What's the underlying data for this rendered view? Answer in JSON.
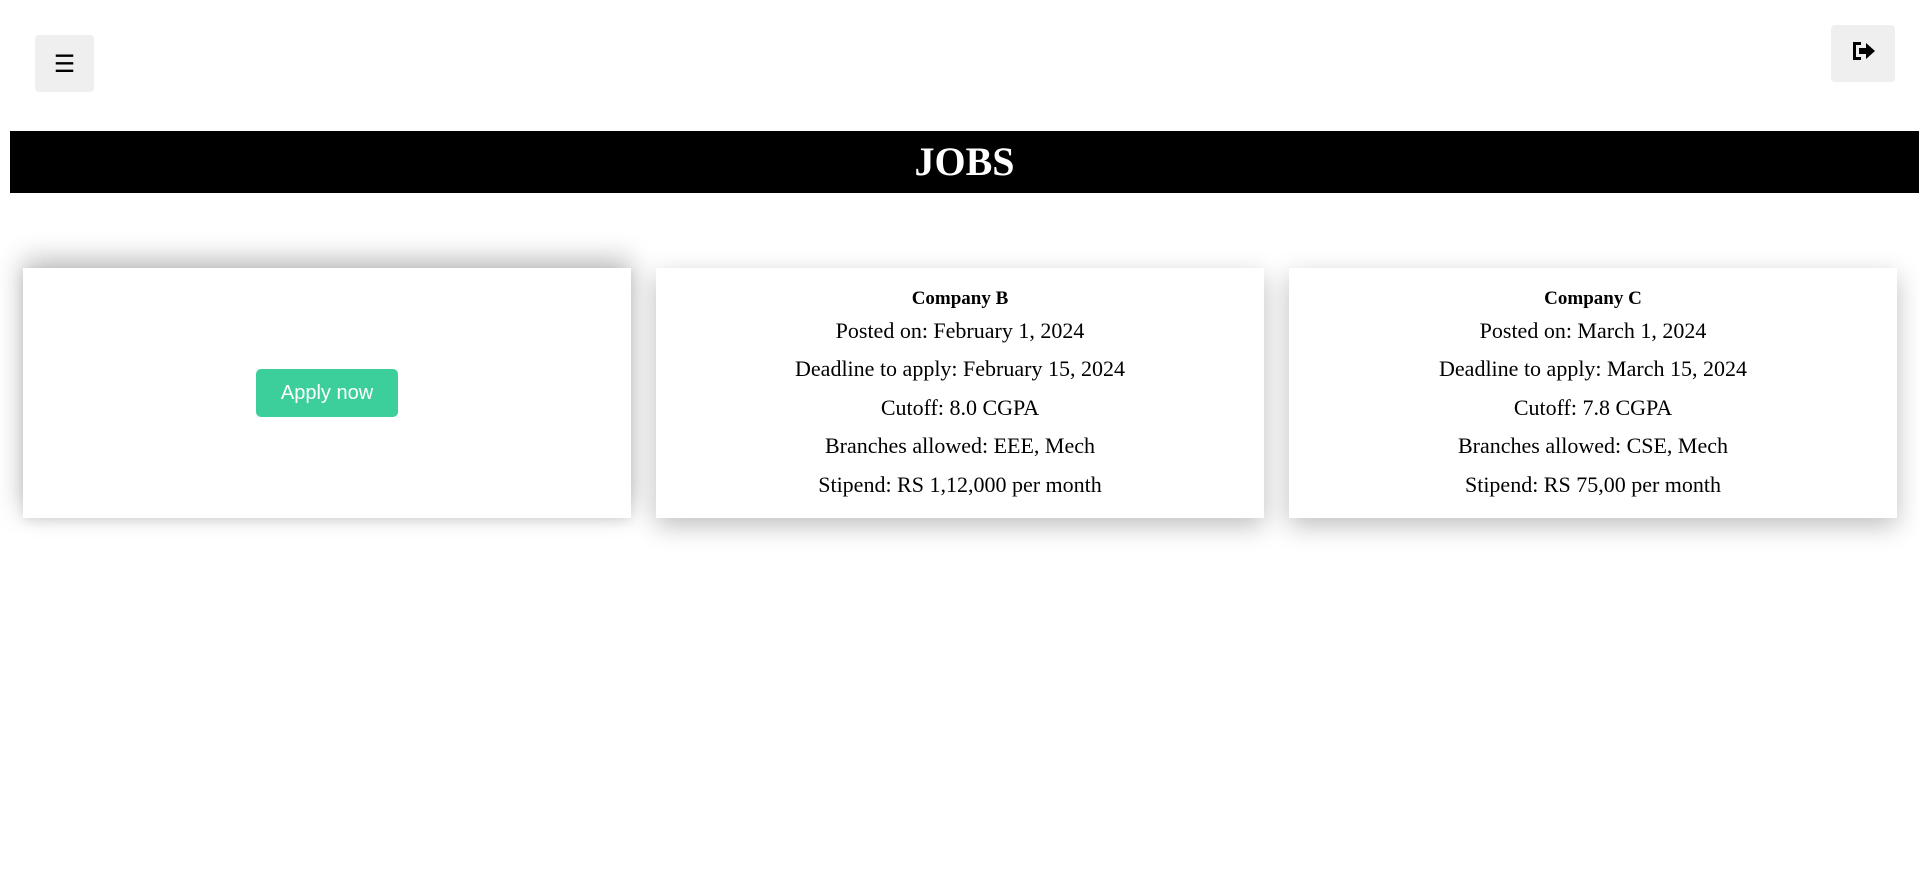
{
  "header": {
    "menu_icon": "☰",
    "logout_icon": "sign-out-icon",
    "title": "JOBS"
  },
  "cards": [
    {
      "apply_label": "Apply now"
    },
    {
      "company": "Company B",
      "posted": "Posted on: February 1, 2024",
      "deadline": "Deadline to apply: February 15, 2024",
      "cutoff": "Cutoff: 8.0 CGPA",
      "branches": "Branches allowed: EEE, Mech",
      "stipend": "Stipend: RS 1,12,000 per month"
    },
    {
      "company": "Company C",
      "posted": "Posted on: March 1, 2024",
      "deadline": "Deadline to apply: March 15, 2024",
      "cutoff": "Cutoff: 7.8 CGPA",
      "branches": "Branches allowed: CSE, Mech",
      "stipend": "Stipend: RS 75,00 per month"
    }
  ],
  "colors": {
    "banner_bg": "#000000",
    "apply_button": "#3ccf9c",
    "icon_button_bg": "#efefef"
  }
}
